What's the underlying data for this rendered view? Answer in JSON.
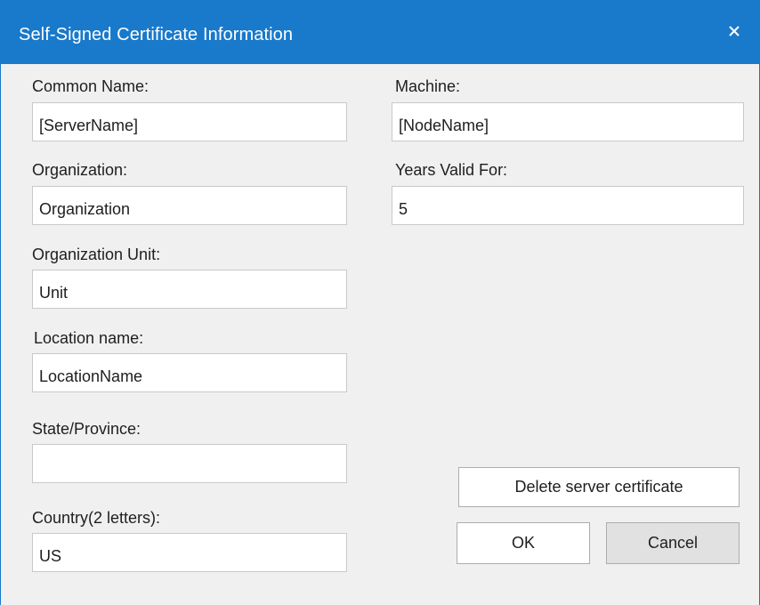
{
  "window": {
    "title": "Self-Signed Certificate Information",
    "close_glyph": "✕"
  },
  "fields": {
    "common_name": {
      "label": "Common Name:",
      "value": "[ServerName]"
    },
    "organization": {
      "label": "Organization:",
      "value": "Organization"
    },
    "organization_unit": {
      "label": "Organization Unit:",
      "value": "Unit"
    },
    "location_name": {
      "label": "Location name:",
      "value": "LocationName"
    },
    "state_province": {
      "label": "State/Province:",
      "value": ""
    },
    "country": {
      "label": "Country(2 letters):",
      "value": "US"
    },
    "machine": {
      "label": "Machine:",
      "value": "[NodeName]"
    },
    "years_valid": {
      "label": "Years Valid For:",
      "value": "5"
    }
  },
  "buttons": {
    "delete_cert": "Delete server certificate",
    "ok": "OK",
    "cancel": "Cancel"
  },
  "colors": {
    "titlebar": "#1979ca",
    "dialog_bg": "#f0f0f0"
  }
}
